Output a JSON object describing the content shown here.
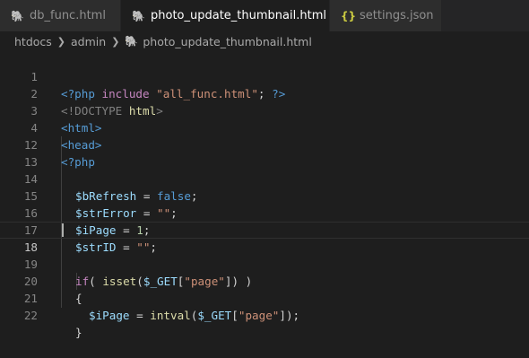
{
  "tabs": [
    {
      "label": "db_func.html",
      "icon": "php-elephant-icon"
    },
    {
      "label": "photo_update_thumbnail.html",
      "icon": "php-elephant-icon",
      "active": true,
      "modified": true
    },
    {
      "label": "settings.json",
      "icon": "json-braces-icon"
    }
  ],
  "breadcrumb": [
    "htdocs",
    "admin",
    "photo_update_thumbnail.html"
  ],
  "editor": {
    "current_line": "18",
    "lines": [
      {
        "num": "1",
        "tokens": [
          "<?php",
          "include",
          "\"all_func.html\"",
          ";",
          "?>"
        ]
      },
      {
        "num": "2",
        "tokens": [
          "<!DOCTYPE",
          "html",
          ">"
        ]
      },
      {
        "num": "3",
        "tokens": [
          "<html>"
        ]
      },
      {
        "num": "4",
        "tokens": [
          "<head>"
        ]
      },
      {
        "num": "12",
        "tokens": [
          "<?php"
        ]
      },
      {
        "num": "13",
        "tokens": []
      },
      {
        "num": "14",
        "tokens": [
          "$bRefresh",
          " = ",
          "false",
          ";"
        ]
      },
      {
        "num": "15",
        "tokens": [
          "$strError",
          " = ",
          "\"\"",
          ";"
        ]
      },
      {
        "num": "16",
        "tokens": [
          "$iPage",
          " = ",
          "1",
          ";"
        ]
      },
      {
        "num": "17",
        "tokens": [
          "$strID",
          " = ",
          "\"\"",
          ";"
        ]
      },
      {
        "num": "18",
        "tokens": []
      },
      {
        "num": "19",
        "tokens": [
          "if",
          "( ",
          "isset",
          "(",
          "$_GET",
          "[",
          "\"page\"",
          "]) )"
        ]
      },
      {
        "num": "20",
        "tokens": [
          "{"
        ]
      },
      {
        "num": "21",
        "tokens": [
          "$iPage",
          " = ",
          "intval",
          "(",
          "$_GET",
          "[",
          "\"page\"",
          "]);"
        ]
      },
      {
        "num": "22",
        "tokens": [
          "}"
        ]
      }
    ]
  },
  "colors": {
    "background": "#1e1e1e",
    "tab_inactive": "#2d2d2d",
    "keyword_blue": "#569cd6",
    "control_purple": "#c586c0",
    "string": "#ce9178",
    "variable": "#9cdcfe",
    "function": "#dcdcaa",
    "number": "#b5cea8"
  }
}
